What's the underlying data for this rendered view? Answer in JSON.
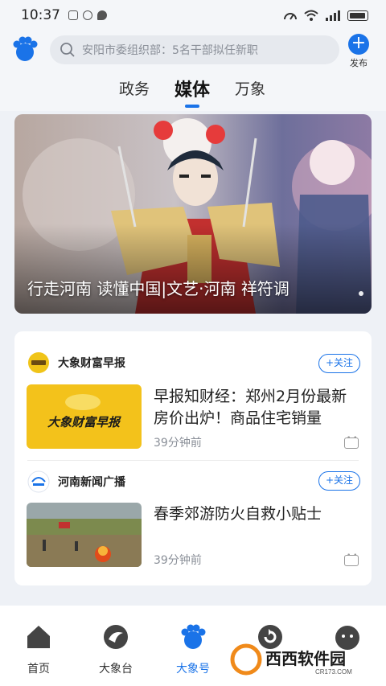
{
  "status_bar": {
    "time": "10:37"
  },
  "header": {
    "search_placeholder": "安阳市委组织部：5名干部拟任新职",
    "publish_label": "发布"
  },
  "tabs": [
    {
      "label": "政务",
      "active": false
    },
    {
      "label": "媒体",
      "active": true
    },
    {
      "label": "万象",
      "active": false
    }
  ],
  "banner": {
    "caption": "行走河南 读懂中国|文艺·河南 祥符调"
  },
  "feed": [
    {
      "source": "大象财富早报",
      "follow_label": "+关注",
      "thumb_text": "大象财富早报",
      "title": "早报知财经：郑州2月份最新房价出炉！商品住宅销量",
      "time": "39分钟前"
    },
    {
      "source": "河南新闻广播",
      "follow_label": "+关注",
      "title": "春季郊游防火自救小贴士",
      "time": "39分钟前"
    }
  ],
  "bottom_nav": [
    {
      "label": "首页",
      "icon": "home-icon",
      "active": false
    },
    {
      "label": "大象台",
      "icon": "swirl-icon",
      "active": false
    },
    {
      "label": "大象号",
      "icon": "paw-icon",
      "active": true
    },
    {
      "label": "",
      "icon": "refresh-icon",
      "active": false
    },
    {
      "label": "",
      "icon": "face-icon",
      "active": false
    }
  ],
  "watermark": {
    "text": "西西软件园",
    "sub": "CR173.COM"
  },
  "colors": {
    "accent": "#1a73e8",
    "background": "#eef1f6"
  }
}
